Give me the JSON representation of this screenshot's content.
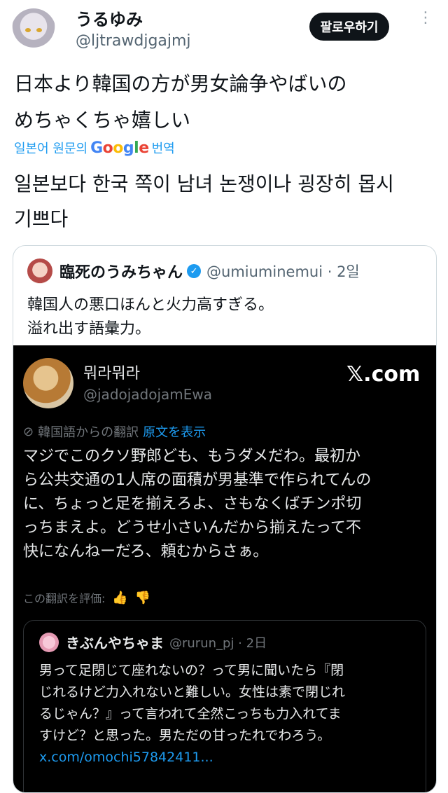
{
  "header": {
    "display_name": "うるゆみ",
    "handle": "@ljtrawdjgajmj",
    "follow_label": "팔로우하기",
    "more_label": "⋮"
  },
  "tweet": {
    "line1": "日本より韓国の方が男女論争やばいの",
    "line2": "めちゃくちゃ嬉しい",
    "translate_prefix": "일본어 원문의",
    "translate_brand": "Google",
    "translate_suffix": "번역",
    "translated_line1": "일본보다 한국 쪽이 남녀 논쟁이나 굉장히 몹시",
    "translated_line2": "기쁘다"
  },
  "quote": {
    "name": "臨死のうみちゃん",
    "verified": "✓",
    "meta": "@umiuminemui · 2일",
    "line1": "韓国人の悪口ほんと火力高すぎる。",
    "line2": "溢れ出す語彙力。"
  },
  "embed": {
    "name": "뭐라뭐라",
    "handle": "@jadojadojamEwa",
    "brand": "𝕏.com",
    "translated_from": "韓国語からの翻訳",
    "show_original": "原文を表示",
    "lines": [
      "マジでこのクソ野郎ども、もうダメだわ。最初か",
      "ら公共交通の1人席の面積が男基準で作られてんの",
      "に、ちょっと足を揃えろよ、さもなくばチンポ切",
      "っちまえよ。どうせ小さいんだから揃えたって不",
      "快になんねーだろ、頼むからさぁ。"
    ],
    "rate_label": "この翻訳を評価:",
    "thumb_up": "👍",
    "thumb_down": "👎"
  },
  "inner": {
    "name": "きぶんやちゃま",
    "meta": "@rurun_pj · 2日",
    "lines": [
      "男って足閉じて座れないの？って男に聞いたら『閉",
      "じれるけど力入れないと難しい。女性は素で閉じれ",
      "るじゃん？』って言われて全然こっちも力入れてま",
      "すけど？と思った。男ただの甘ったれでわろう。"
    ],
    "link": "x.com/omochi57842411..."
  }
}
